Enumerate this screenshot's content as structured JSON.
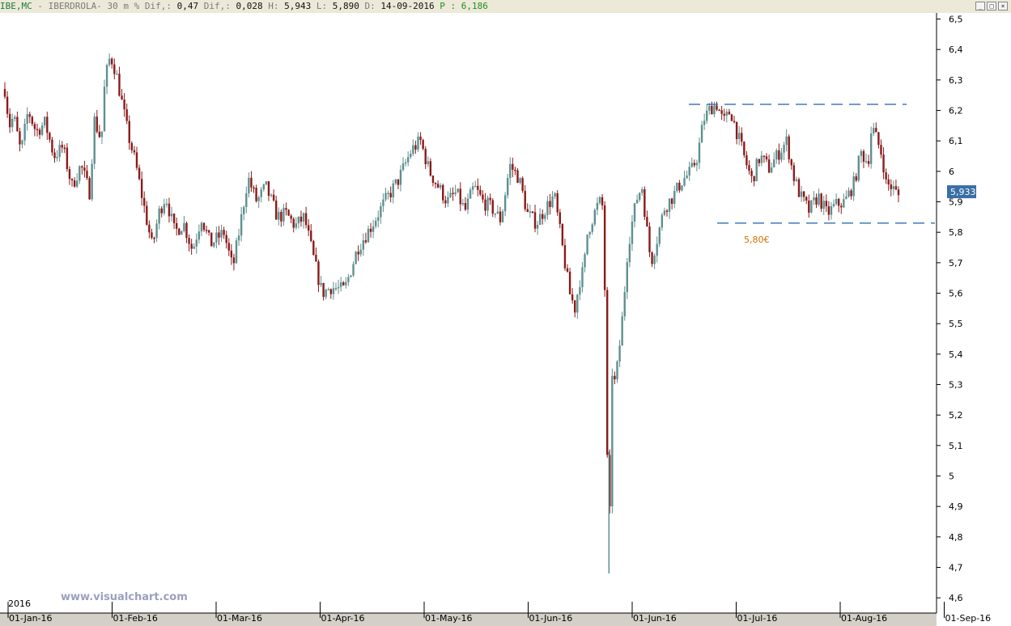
{
  "header": {
    "symbol": "IBE,MC",
    "sep": " - ",
    "name": "IBERDROLA",
    "timeframe": "-   30 m %",
    "dif_pct_label": " Dif,:",
    "dif_pct_value": " 0,47",
    "dif_label": " Dif,:",
    "dif_value": " 0,028",
    "h_label": " H:",
    "h_value": " 5,943",
    "l_label": " L:",
    "l_value": " 5,890",
    "d_label": " D:",
    "d_value": " 14-09-2016",
    "p_label": " P :",
    "p_value": " 6,186"
  },
  "window_buttons": [
    "_",
    "□",
    "×"
  ],
  "chart_data": {
    "type": "candlestick",
    "title": "",
    "ylim": [
      4.55,
      6.52
    ],
    "y_ticks": [
      "6,5",
      "6,4",
      "6,3",
      "6,2",
      "6,1",
      "6",
      "5,9",
      "5,8",
      "5,7",
      "5,6",
      "5,5",
      "5,4",
      "5,3",
      "5,2",
      "5,1",
      "5",
      "4,9",
      "4,8",
      "4,7",
      "4,6"
    ],
    "y_tick_values": [
      6.5,
      6.4,
      6.3,
      6.2,
      6.1,
      6.0,
      5.9,
      5.8,
      5.7,
      5.6,
      5.5,
      5.4,
      5.3,
      5.2,
      5.1,
      5.0,
      4.9,
      4.8,
      4.7,
      4.6
    ],
    "x_labels": [
      "01-Jan-16",
      "01-Feb-16",
      "01-Mar-16",
      "01-Apr-16",
      "01-May-16",
      "01-Jun-16",
      "01-Jun-16",
      "01-Jul-16",
      "01-Aug-16",
      "01-Sep-16"
    ],
    "year_label": "2016",
    "last_price_label": "5,933",
    "last_price": 5.933,
    "series_path": [
      [
        0.0,
        6.27
      ],
      [
        0.005,
        6.15
      ],
      [
        0.01,
        6.18
      ],
      [
        0.018,
        6.06
      ],
      [
        0.026,
        6.2
      ],
      [
        0.035,
        6.13
      ],
      [
        0.045,
        6.16
      ],
      [
        0.055,
        6.05
      ],
      [
        0.065,
        6.08
      ],
      [
        0.075,
        5.95
      ],
      [
        0.085,
        6.02
      ],
      [
        0.095,
        5.93
      ],
      [
        0.1,
        6.17
      ],
      [
        0.108,
        6.1
      ],
      [
        0.112,
        6.3
      ],
      [
        0.118,
        6.38
      ],
      [
        0.124,
        6.33
      ],
      [
        0.13,
        6.24
      ],
      [
        0.138,
        6.12
      ],
      [
        0.146,
        6.03
      ],
      [
        0.156,
        5.88
      ],
      [
        0.165,
        5.75
      ],
      [
        0.172,
        5.86
      ],
      [
        0.18,
        5.92
      ],
      [
        0.19,
        5.8
      ],
      [
        0.2,
        5.83
      ],
      [
        0.21,
        5.74
      ],
      [
        0.22,
        5.85
      ],
      [
        0.23,
        5.76
      ],
      [
        0.245,
        5.8
      ],
      [
        0.255,
        5.68
      ],
      [
        0.262,
        5.8
      ],
      [
        0.272,
        5.98
      ],
      [
        0.282,
        5.9
      ],
      [
        0.292,
        5.95
      ],
      [
        0.305,
        5.85
      ],
      [
        0.315,
        5.86
      ],
      [
        0.325,
        5.82
      ],
      [
        0.335,
        5.85
      ],
      [
        0.345,
        5.72
      ],
      [
        0.355,
        5.6
      ],
      [
        0.365,
        5.62
      ],
      [
        0.38,
        5.61
      ],
      [
        0.395,
        5.75
      ],
      [
        0.41,
        5.82
      ],
      [
        0.425,
        5.9
      ],
      [
        0.44,
        5.97
      ],
      [
        0.455,
        6.07
      ],
      [
        0.465,
        6.1
      ],
      [
        0.475,
        6.0
      ],
      [
        0.485,
        5.95
      ],
      [
        0.495,
        5.9
      ],
      [
        0.505,
        5.93
      ],
      [
        0.515,
        5.87
      ],
      [
        0.525,
        5.95
      ],
      [
        0.535,
        5.9
      ],
      [
        0.545,
        5.88
      ],
      [
        0.555,
        5.84
      ],
      [
        0.565,
        6.02
      ],
      [
        0.575,
        5.98
      ],
      [
        0.585,
        5.86
      ],
      [
        0.595,
        5.83
      ],
      [
        0.605,
        5.88
      ],
      [
        0.615,
        5.92
      ],
      [
        0.625,
        5.73
      ],
      [
        0.632,
        5.6
      ],
      [
        0.638,
        5.55
      ],
      [
        0.643,
        5.64
      ],
      [
        0.648,
        5.68
      ],
      [
        0.652,
        5.8
      ],
      [
        0.658,
        5.85
      ],
      [
        0.665,
        5.9
      ],
      [
        0.67,
        5.88
      ],
      [
        0.674,
        5.07
      ],
      [
        0.676,
        4.68
      ],
      [
        0.679,
        5.35
      ],
      [
        0.683,
        5.3
      ],
      [
        0.687,
        5.4
      ],
      [
        0.692,
        5.55
      ],
      [
        0.697,
        5.75
      ],
      [
        0.703,
        5.85
      ],
      [
        0.708,
        5.92
      ],
      [
        0.713,
        5.95
      ],
      [
        0.718,
        5.82
      ],
      [
        0.723,
        5.7
      ],
      [
        0.73,
        5.78
      ],
      [
        0.738,
        5.88
      ],
      [
        0.748,
        5.92
      ],
      [
        0.758,
        5.97
      ],
      [
        0.768,
        6.0
      ],
      [
        0.775,
        6.05
      ],
      [
        0.782,
        6.17
      ],
      [
        0.79,
        6.21
      ],
      [
        0.797,
        6.22
      ],
      [
        0.804,
        6.16
      ],
      [
        0.812,
        6.2
      ],
      [
        0.82,
        6.12
      ],
      [
        0.828,
        6.04
      ],
      [
        0.836,
        5.97
      ],
      [
        0.845,
        6.05
      ],
      [
        0.855,
        6.01
      ],
      [
        0.866,
        6.06
      ],
      [
        0.875,
        6.1
      ],
      [
        0.882,
        5.99
      ],
      [
        0.89,
        5.92
      ],
      [
        0.9,
        5.87
      ],
      [
        0.91,
        5.92
      ],
      [
        0.92,
        5.86
      ],
      [
        0.93,
        5.89
      ],
      [
        0.94,
        5.9
      ],
      [
        0.95,
        5.96
      ],
      [
        0.958,
        6.06
      ],
      [
        0.966,
        6.03
      ],
      [
        0.97,
        6.15
      ],
      [
        0.976,
        6.1
      ],
      [
        0.982,
        6.05
      ],
      [
        0.986,
        5.96
      ],
      [
        0.992,
        5.95
      ],
      [
        1.0,
        5.92
      ]
    ],
    "resistance_level": 6.22,
    "support_level": 5.83,
    "support_label": "5,80€",
    "watermark": "www.visualchart.com",
    "colors": {
      "background": "#ffffff",
      "up_candle": "#5f8f8f",
      "down_candle": "#8b1a1a",
      "level_lines": "#1a5fb4",
      "support_text": "#d07000",
      "price_tag_bg": "#3a6ea5",
      "watermark": "#9aa0c0"
    }
  }
}
